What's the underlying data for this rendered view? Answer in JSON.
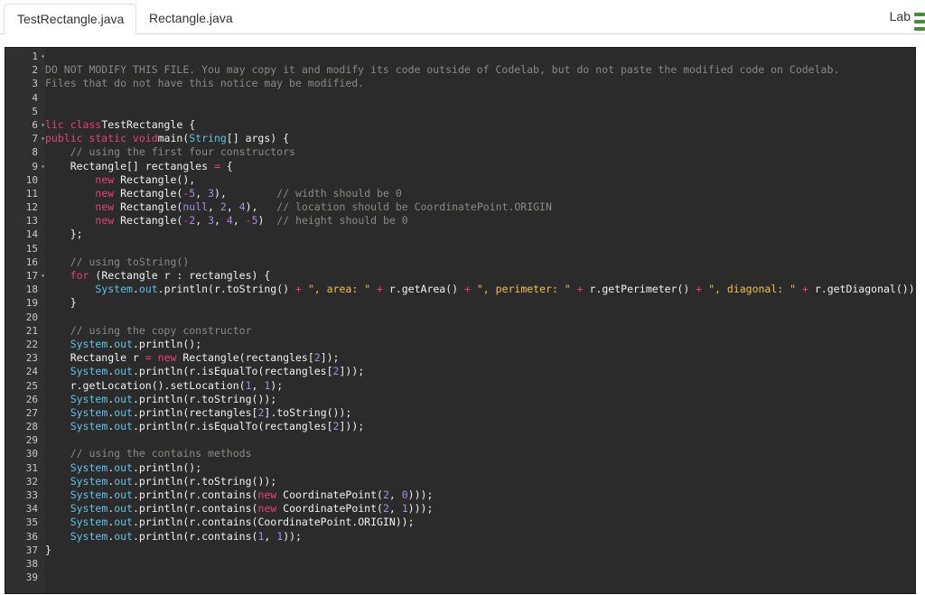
{
  "tabs": [
    {
      "label": "TestRectangle.java",
      "active": true
    },
    {
      "label": "Rectangle.java",
      "active": false
    }
  ],
  "header": {
    "lab_label": "Lab"
  },
  "editor": {
    "line_numbers": [
      "1",
      "2",
      "3",
      "4",
      "5",
      "6",
      "7",
      "8",
      "9",
      "10",
      "11",
      "12",
      "13",
      "14",
      "15",
      "16",
      "17",
      "18",
      "19",
      "20",
      "21",
      "22",
      "23",
      "24",
      "25",
      "26",
      "27",
      "28",
      "29",
      "30",
      "31",
      "32",
      "33",
      "34",
      "35",
      "36",
      "37",
      "38",
      "39"
    ],
    "fold_lines": [
      1,
      6,
      7,
      9,
      17
    ],
    "colors": {
      "background": "#2a2b2a",
      "keyword": "#e8417a",
      "comment": "#8a8a86",
      "string": "#f0c24c",
      "number": "#a98be6",
      "system": "#5ec4e6"
    },
    "lines": [
      [],
      [
        [
          "cm",
          "DO NOT MODIFY THIS FILE. You may copy it and modify its code outside of Codelab, but do not paste the modified code on Codelab."
        ]
      ],
      [
        [
          "cm",
          "Files that do not have this notice may be modified."
        ]
      ],
      [],
      [],
      [
        [
          "kw",
          "lic class"
        ],
        [
          "",
          "TestRectangle {"
        ]
      ],
      [
        [
          "",
          ""
        ],
        [
          "kw",
          "public static void"
        ],
        [
          "",
          "main("
        ],
        [
          "sys",
          "String"
        ],
        [
          "",
          "[] args) {"
        ]
      ],
      [
        [
          "",
          "    "
        ],
        [
          "cm",
          "// using the first four constructors"
        ]
      ],
      [
        [
          "",
          "    Rectangle[] rectangles "
        ],
        [
          "kw",
          "="
        ],
        [
          "",
          " {"
        ]
      ],
      [
        [
          "",
          "        "
        ],
        [
          "kw",
          "new"
        ],
        [
          "",
          " Rectangle(),"
        ]
      ],
      [
        [
          "",
          "        "
        ],
        [
          "kw",
          "new"
        ],
        [
          "",
          " Rectangle("
        ],
        [
          "kw",
          "-"
        ],
        [
          "num",
          "5"
        ],
        [
          "",
          ", "
        ],
        [
          "num",
          "3"
        ],
        [
          "",
          "),        "
        ],
        [
          "cm",
          "// width should be 0"
        ]
      ],
      [
        [
          "",
          "        "
        ],
        [
          "kw",
          "new"
        ],
        [
          "",
          " Rectangle("
        ],
        [
          "num",
          "null"
        ],
        [
          "",
          ", "
        ],
        [
          "num",
          "2"
        ],
        [
          "",
          ", "
        ],
        [
          "num",
          "4"
        ],
        [
          "",
          "),   "
        ],
        [
          "cm",
          "// location should be CoordinatePoint.ORIGIN"
        ]
      ],
      [
        [
          "",
          "        "
        ],
        [
          "kw",
          "new"
        ],
        [
          "",
          " Rectangle("
        ],
        [
          "kw",
          "-"
        ],
        [
          "num",
          "2"
        ],
        [
          "",
          ", "
        ],
        [
          "num",
          "3"
        ],
        [
          "",
          ", "
        ],
        [
          "num",
          "4"
        ],
        [
          "",
          ", "
        ],
        [
          "kw",
          "-"
        ],
        [
          "num",
          "5"
        ],
        [
          "",
          ")  "
        ],
        [
          "cm",
          "// height should be 0"
        ]
      ],
      [
        [
          "",
          "    };"
        ]
      ],
      [],
      [
        [
          "",
          "    "
        ],
        [
          "cm",
          "// using toString()"
        ]
      ],
      [
        [
          "",
          "    "
        ],
        [
          "kw",
          "for"
        ],
        [
          "",
          " (Rectangle r : rectangles) {"
        ]
      ],
      [
        [
          "",
          "        "
        ],
        [
          "sys",
          "System"
        ],
        [
          "",
          "."
        ],
        [
          "sys",
          "out"
        ],
        [
          "",
          ".println(r.toString() "
        ],
        [
          "kw",
          "+"
        ],
        [
          "",
          " "
        ],
        [
          "str",
          "\", area: \""
        ],
        [
          "",
          " "
        ],
        [
          "kw",
          "+"
        ],
        [
          "",
          " r.getArea() "
        ],
        [
          "kw",
          "+"
        ],
        [
          "",
          " "
        ],
        [
          "str",
          "\", perimeter: \""
        ],
        [
          "",
          " "
        ],
        [
          "kw",
          "+"
        ],
        [
          "",
          " r.getPerimeter() "
        ],
        [
          "kw",
          "+"
        ],
        [
          "",
          " "
        ],
        [
          "str",
          "\", diagonal: \""
        ],
        [
          "",
          " "
        ],
        [
          "kw",
          "+"
        ],
        [
          "",
          " r.getDiagonal());"
        ]
      ],
      [
        [
          "",
          "    }"
        ]
      ],
      [],
      [
        [
          "",
          "    "
        ],
        [
          "cm",
          "// using the copy constructor"
        ]
      ],
      [
        [
          "",
          "    "
        ],
        [
          "sys",
          "System"
        ],
        [
          "",
          "."
        ],
        [
          "sys",
          "out"
        ],
        [
          "",
          ".println();"
        ]
      ],
      [
        [
          "",
          "    Rectangle r "
        ],
        [
          "kw",
          "="
        ],
        [
          "",
          " "
        ],
        [
          "kw",
          "new"
        ],
        [
          "",
          " Rectangle(rectangles["
        ],
        [
          "num",
          "2"
        ],
        [
          "",
          "]);"
        ]
      ],
      [
        [
          "",
          "    "
        ],
        [
          "sys",
          "System"
        ],
        [
          "",
          "."
        ],
        [
          "sys",
          "out"
        ],
        [
          "",
          ".println(r.isEqualTo(rectangles["
        ],
        [
          "num",
          "2"
        ],
        [
          "",
          "]));"
        ]
      ],
      [
        [
          "",
          "    r.getLocation().setLocation("
        ],
        [
          "num",
          "1"
        ],
        [
          "",
          ", "
        ],
        [
          "num",
          "1"
        ],
        [
          "",
          ");"
        ]
      ],
      [
        [
          "",
          "    "
        ],
        [
          "sys",
          "System"
        ],
        [
          "",
          "."
        ],
        [
          "sys",
          "out"
        ],
        [
          "",
          ".println(r.toString());"
        ]
      ],
      [
        [
          "",
          "    "
        ],
        [
          "sys",
          "System"
        ],
        [
          "",
          "."
        ],
        [
          "sys",
          "out"
        ],
        [
          "",
          ".println(rectangles["
        ],
        [
          "num",
          "2"
        ],
        [
          "",
          "].toString());"
        ]
      ],
      [
        [
          "",
          "    "
        ],
        [
          "sys",
          "System"
        ],
        [
          "",
          "."
        ],
        [
          "sys",
          "out"
        ],
        [
          "",
          ".println(r.isEqualTo(rectangles["
        ],
        [
          "num",
          "2"
        ],
        [
          "",
          "]));"
        ]
      ],
      [],
      [
        [
          "",
          "    "
        ],
        [
          "cm",
          "// using the contains methods"
        ]
      ],
      [
        [
          "",
          "    "
        ],
        [
          "sys",
          "System"
        ],
        [
          "",
          "."
        ],
        [
          "sys",
          "out"
        ],
        [
          "",
          ".println();"
        ]
      ],
      [
        [
          "",
          "    "
        ],
        [
          "sys",
          "System"
        ],
        [
          "",
          "."
        ],
        [
          "sys",
          "out"
        ],
        [
          "",
          ".println(r.toString());"
        ]
      ],
      [
        [
          "",
          "    "
        ],
        [
          "sys",
          "System"
        ],
        [
          "",
          "."
        ],
        [
          "sys",
          "out"
        ],
        [
          "",
          ".println(r.contains("
        ],
        [
          "kw",
          "new"
        ],
        [
          "",
          " CoordinatePoint("
        ],
        [
          "num",
          "2"
        ],
        [
          "",
          ", "
        ],
        [
          "num",
          "0"
        ],
        [
          "",
          ")));"
        ]
      ],
      [
        [
          "",
          "    "
        ],
        [
          "sys",
          "System"
        ],
        [
          "",
          "."
        ],
        [
          "sys",
          "out"
        ],
        [
          "",
          ".println(r.contains("
        ],
        [
          "kw",
          "new"
        ],
        [
          "",
          " CoordinatePoint("
        ],
        [
          "num",
          "2"
        ],
        [
          "",
          ", "
        ],
        [
          "num",
          "1"
        ],
        [
          "",
          ")));"
        ]
      ],
      [
        [
          "",
          "    "
        ],
        [
          "sys",
          "System"
        ],
        [
          "",
          "."
        ],
        [
          "sys",
          "out"
        ],
        [
          "",
          ".println(r.contains(CoordinatePoint.ORIGIN));"
        ]
      ],
      [
        [
          "",
          "    "
        ],
        [
          "sys",
          "System"
        ],
        [
          "",
          "."
        ],
        [
          "sys",
          "out"
        ],
        [
          "",
          ".println(r.contains("
        ],
        [
          "num",
          "1"
        ],
        [
          "",
          ", "
        ],
        [
          "num",
          "1"
        ],
        [
          "",
          "));"
        ]
      ],
      [
        [
          "",
          "}"
        ]
      ],
      [],
      []
    ]
  }
}
